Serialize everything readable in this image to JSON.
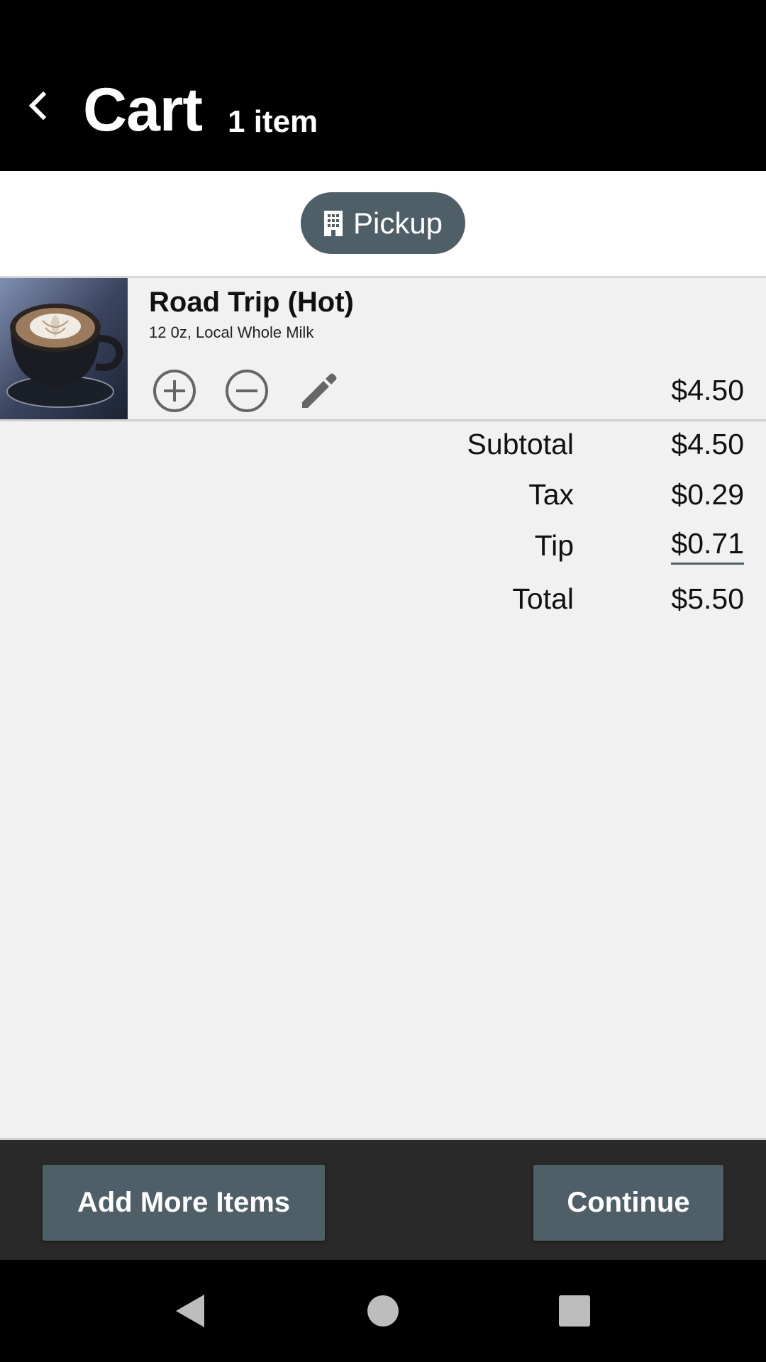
{
  "header": {
    "title": "Cart",
    "item_count": "1 item"
  },
  "mode": {
    "label": "Pickup",
    "icon": "building-icon",
    "color": "#4f5f67"
  },
  "cart": {
    "items": [
      {
        "name": "Road Trip (Hot)",
        "options": "12 0z, Local Whole Milk",
        "price": "$4.50",
        "image": "latte-photo"
      }
    ]
  },
  "summary": {
    "subtotal_label": "Subtotal",
    "subtotal_value": "$4.50",
    "tax_label": "Tax",
    "tax_value": "$0.29",
    "tip_label": "Tip",
    "tip_value": "$0.71",
    "total_label": "Total",
    "total_value": "$5.50"
  },
  "actions": {
    "add_more_label": "Add More Items",
    "continue_label": "Continue"
  },
  "colors": {
    "header_bg": "#000000",
    "accent": "#4f5f67",
    "bottom_bar": "#292929",
    "background": "#f1f1f1"
  }
}
